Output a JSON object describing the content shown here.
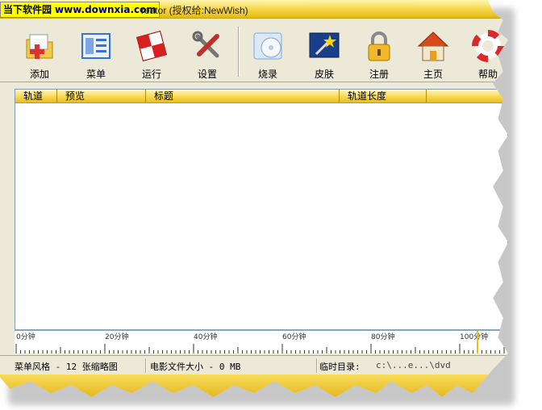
{
  "window": {
    "title_suffix": "reator (授权给:NewWish)",
    "watermark_cn": "当下软件园",
    "watermark_url": "www.downxia.com"
  },
  "toolbar": {
    "items": [
      {
        "label": "添加",
        "icon": "add-folder-icon",
        "color": "#e03030"
      },
      {
        "label": "菜单",
        "icon": "menu-layout-icon",
        "color": "#3a6fd8"
      },
      {
        "label": "运行",
        "icon": "run-flag-icon",
        "color": "#d82020"
      },
      {
        "label": "设置",
        "icon": "tools-icon",
        "color": "#c0302a"
      },
      {
        "label": "烧录",
        "icon": "burn-disc-icon",
        "color": "#7aa6e0"
      },
      {
        "label": "皮肤",
        "icon": "skin-wand-icon",
        "color": "#1a3f8a"
      },
      {
        "label": "注册",
        "icon": "lock-icon",
        "color": "#e8a81a"
      },
      {
        "label": "主页",
        "icon": "home-icon",
        "color": "#d84a1a"
      },
      {
        "label": "帮助",
        "icon": "lifebuoy-icon",
        "color": "#d82a2a"
      }
    ]
  },
  "list": {
    "columns": [
      "轨道",
      "预览",
      "标题",
      "轨道长度"
    ],
    "side_buttons": [
      {
        "icon": "move-down-arrow-icon",
        "glyph": "⇩",
        "color": "#1a9a1a"
      },
      {
        "icon": "delete-x-icon",
        "glyph": "✕",
        "color": "#d82020"
      }
    ]
  },
  "ruler": {
    "labels": [
      "0分钟",
      "20分钟",
      "40分钟",
      "60分钟",
      "80分钟",
      "100分钟"
    ],
    "max_minutes": 110
  },
  "status": {
    "menu_style": "菜单风格 - 12 张缩略图",
    "file_size": "电影文件大小 - 0 MB",
    "temp_dir_label": "临时目录:",
    "temp_dir_value": "c:\\...e...\\dvd"
  }
}
